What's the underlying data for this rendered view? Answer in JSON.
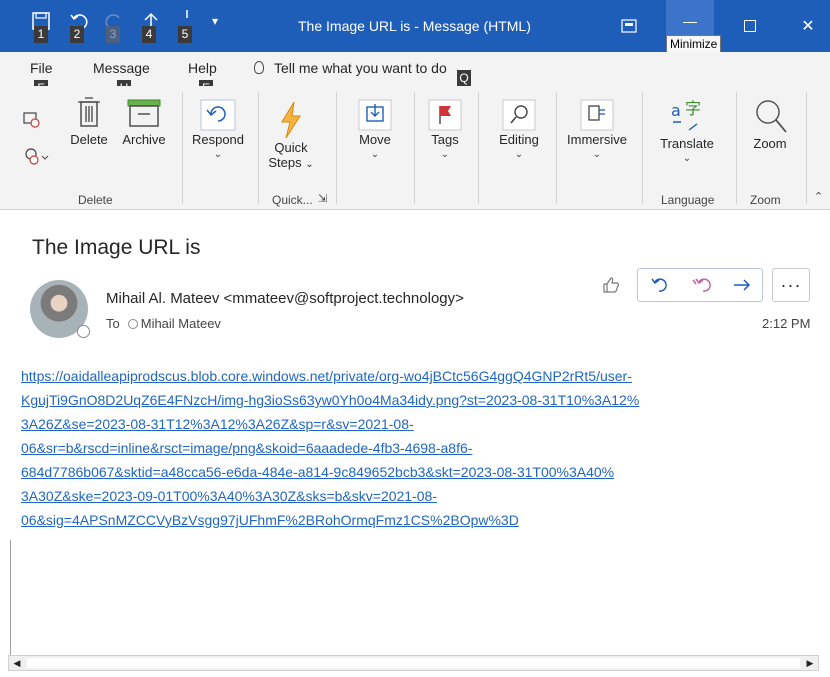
{
  "window": {
    "title": "The Image URL is  -  Message (HTML)",
    "tooltip": "Minimize"
  },
  "qat": {
    "keytips": [
      "1",
      "2",
      "3",
      "4",
      "5"
    ]
  },
  "tabs": [
    {
      "label": "File",
      "keytip": "F"
    },
    {
      "label": "Message",
      "keytip": "H"
    },
    {
      "label": "Help",
      "keytip": "E"
    }
  ],
  "tellme": {
    "text": "Tell me what you want to do",
    "keytip": "Q"
  },
  "ribbon": {
    "delete_group": {
      "delete": "Delete",
      "archive": "Archive",
      "label": "Delete"
    },
    "respond": "Respond",
    "quick_steps": {
      "line1": "Quick",
      "line2": "Steps",
      "label": "Quick..."
    },
    "move": "Move",
    "tags": "Tags",
    "editing": "Editing",
    "immersive": "Immersive",
    "translate": "Translate",
    "language_label": "Language",
    "zoom": "Zoom",
    "zoom_label": "Zoom"
  },
  "message": {
    "subject": "The Image URL is",
    "sender": "Mihail Al. Mateev <mmateev@softproject.technology>",
    "to_label": "To",
    "recipient": "Mihail Mateev",
    "time": "2:12 PM",
    "url_lines": [
      "https://oaidalleapiprodscus.blob.core.windows.net/private/org-wo4jBCtc56G4ggQ4GNP2rRt5/user-",
      "KgujTi9GnO8D2UqZ6E4FNzcH/img-hg3ioSs63yw0Yh0o4Ma34idy.png?st=2023-08-31T10%3A12%",
      "3A26Z&se=2023-08-31T12%3A12%3A26Z&sp=r&sv=2021-08-",
      "06&sr=b&rscd=inline&rsct=image/png&skoid=6aaadede-4fb3-4698-a8f6-",
      "684d7786b067&sktid=a48cca56-e6da-484e-a814-9c849652bcb3&skt=2023-08-31T00%3A40%",
      "3A30Z&ske=2023-09-01T00%3A40%3A30Z&sks=b&skv=2021-08-",
      "06&sig=4APSnMZCCVyBzVsgg97jUFhmF%2BRohOrmqFmz1CS%2BOpw%3D"
    ]
  },
  "colors": {
    "titlebar": "#1f5eb8",
    "link": "#2167c2",
    "ribbon_bg": "#f3f3f3"
  },
  "icons": {
    "save": "save-icon",
    "undo": "undo-icon",
    "redo": "redo-icon",
    "upload": "upload-icon",
    "ignore": "ignore-icon",
    "delete": "trash-icon",
    "archive": "archive-icon",
    "respond": "reply-icon",
    "quick_steps": "lightning-icon",
    "move": "move-icon",
    "tags": "flag-icon",
    "editing": "search-icon",
    "immersive": "immersive-reader-icon",
    "translate": "translate-icon",
    "zoom": "zoom-icon"
  }
}
